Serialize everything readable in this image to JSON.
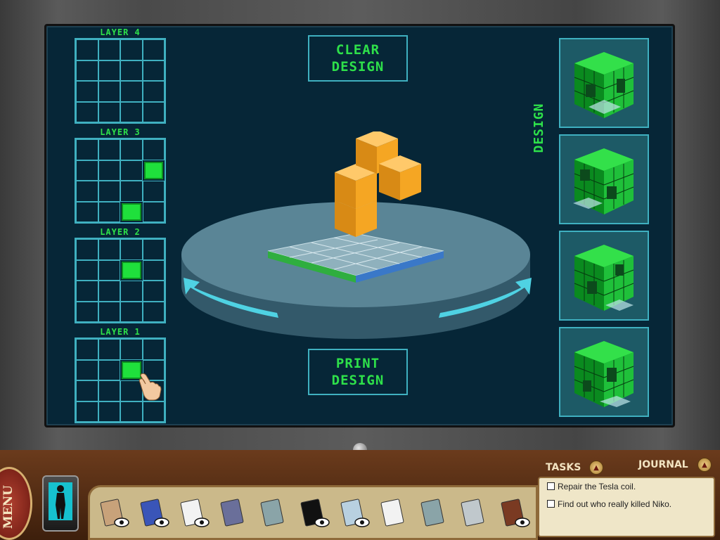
{
  "layers": [
    {
      "label": "LAYER 4",
      "cells": [
        [
          0,
          0,
          0,
          0
        ],
        [
          0,
          0,
          0,
          0
        ],
        [
          0,
          0,
          0,
          0
        ],
        [
          0,
          0,
          0,
          0
        ]
      ]
    },
    {
      "label": "LAYER 3",
      "cells": [
        [
          0,
          0,
          0,
          0
        ],
        [
          0,
          0,
          0,
          1
        ],
        [
          0,
          0,
          0,
          0
        ],
        [
          0,
          0,
          1,
          0
        ]
      ]
    },
    {
      "label": "LAYER 2",
      "cells": [
        [
          0,
          0,
          0,
          0
        ],
        [
          0,
          0,
          1,
          0
        ],
        [
          0,
          0,
          0,
          0
        ],
        [
          0,
          0,
          0,
          0
        ]
      ]
    },
    {
      "label": "LAYER 1",
      "cells": [
        [
          0,
          0,
          0,
          0
        ],
        [
          0,
          0,
          1,
          0
        ],
        [
          0,
          0,
          0,
          0
        ],
        [
          0,
          0,
          0,
          0
        ]
      ]
    }
  ],
  "buttons": {
    "clear": "CLEAR\nDESIGN",
    "print": "PRINT\nDESIGN"
  },
  "design_label": "DESIGN",
  "design_count": 4,
  "menu_label": "MENU",
  "tasks": {
    "tab_label": "TASKS",
    "journal_label": "JOURNAL",
    "items": [
      "Repair the Tesla coil.",
      "Find out who really killed Niko."
    ]
  },
  "inventory": [
    {
      "name": "envelope",
      "color": "#c8a27a",
      "eye": true
    },
    {
      "name": "tesla-book",
      "color": "#3a55b8",
      "eye": true
    },
    {
      "name": "document",
      "color": "#f2f2f2",
      "eye": true
    },
    {
      "name": "cd-disc",
      "color": "#6a6f9a",
      "eye": false
    },
    {
      "name": "clipboard",
      "color": "#8aa4a8",
      "eye": false
    },
    {
      "name": "black-folder",
      "color": "#111111",
      "eye": true
    },
    {
      "name": "map",
      "color": "#b8d0e0",
      "eye": true
    },
    {
      "name": "paper-note",
      "color": "#f2f2f2",
      "eye": false
    },
    {
      "name": "slate",
      "color": "#8aa4a8",
      "eye": false
    },
    {
      "name": "vial-tray",
      "color": "#c0c8cc",
      "eye": false
    },
    {
      "name": "leather-book",
      "color": "#7a3a22",
      "eye": true
    }
  ],
  "colors": {
    "accent_green": "#2ee04a",
    "grid_cyan": "#3fb0c0",
    "block_orange": "#f5a623"
  }
}
